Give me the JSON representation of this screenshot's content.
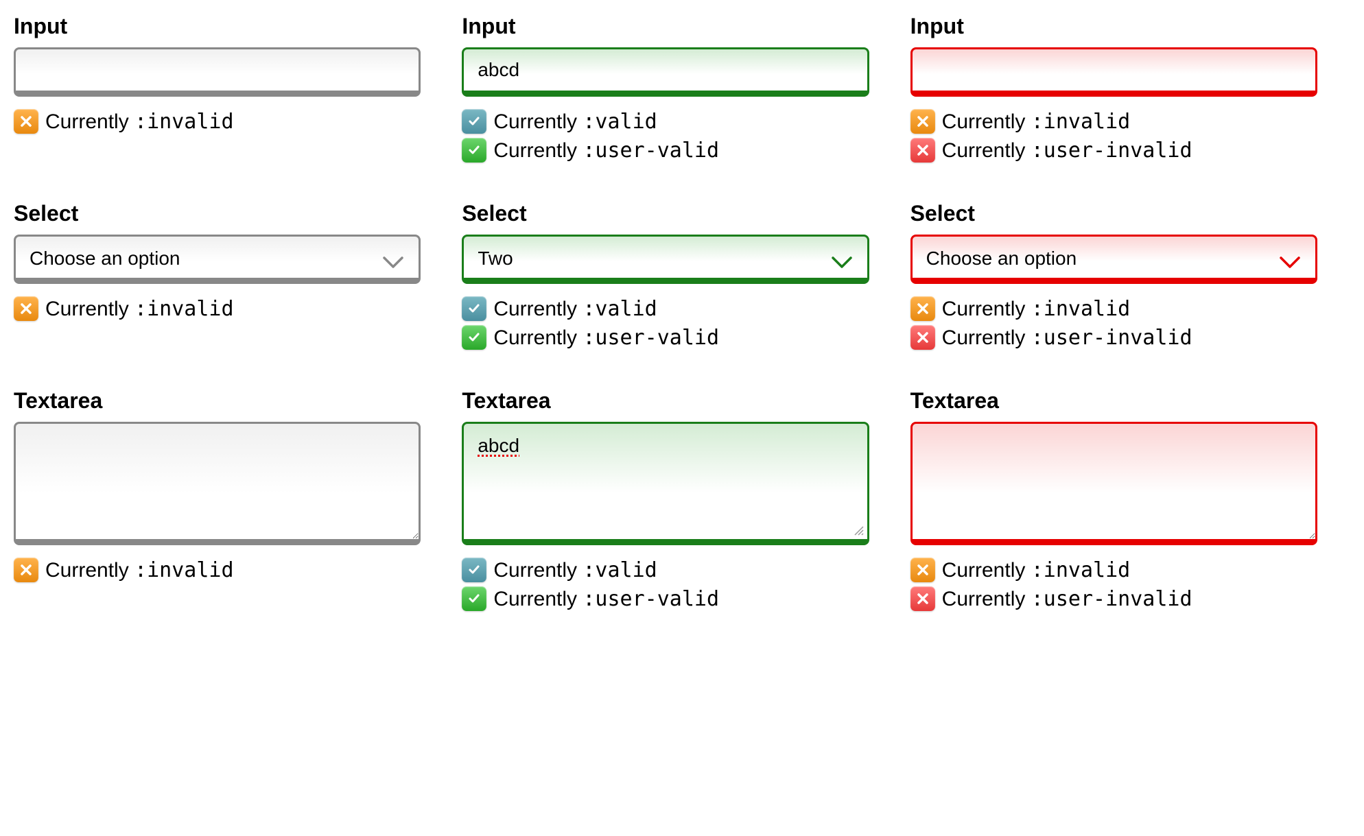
{
  "labels": {
    "input": "Input",
    "select": "Select",
    "textarea": "Textarea"
  },
  "status": {
    "prefix": "Currently ",
    "invalid": ":invalid",
    "valid": ":valid",
    "user_valid": ":user-valid",
    "user_invalid": ":user-invalid"
  },
  "values": {
    "input_col2": "abcd",
    "input_col1": "",
    "input_col3": "",
    "select_col1": "Choose an option",
    "select_col2": "Two",
    "select_col3": "Choose an option",
    "textarea_col1": "",
    "textarea_col2": "abcd",
    "textarea_col3": ""
  },
  "colors": {
    "neutral_border": "#888888",
    "valid_border": "#1a7e1a",
    "invalid_border": "#e60000"
  }
}
